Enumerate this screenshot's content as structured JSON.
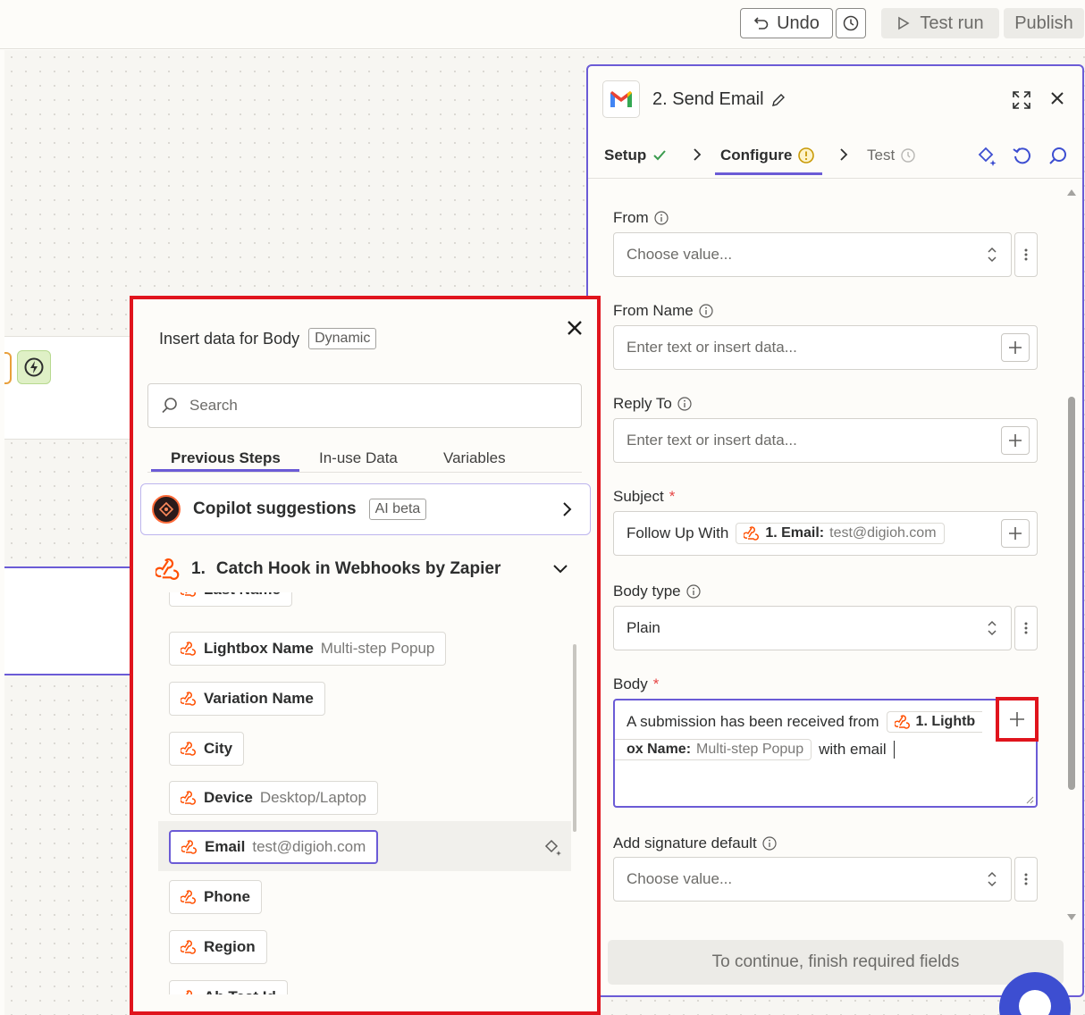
{
  "toolbar": {
    "undo_label": "Undo",
    "test_run_label": "Test run",
    "publish_label": "Publish"
  },
  "editor": {
    "title": "2. Send Email",
    "tabs": {
      "setup": "Setup",
      "configure": "Configure",
      "test": "Test"
    },
    "fields": {
      "from": {
        "label": "From",
        "placeholder": "Choose value..."
      },
      "from_name": {
        "label": "From Name",
        "placeholder": "Enter text or insert data..."
      },
      "reply_to": {
        "label": "Reply To",
        "placeholder": "Enter text or insert data..."
      },
      "subject": {
        "label": "Subject",
        "required": "*",
        "text": "Follow Up With",
        "pill_key": "1. Email:",
        "pill_value": "test@digioh.com"
      },
      "body_type": {
        "label": "Body type",
        "value": "Plain"
      },
      "body": {
        "label": "Body",
        "required": "*",
        "text1": "A submission has been received from",
        "pill_key1": "1. Lightb",
        "pill_key2": "ox Name:",
        "pill_value": "Multi-step Popup",
        "text2": "with email"
      },
      "signature": {
        "label": "Add signature default",
        "placeholder": "Choose value..."
      }
    },
    "continue_label": "To continue, finish required fields"
  },
  "insert_panel": {
    "title": "Insert data for Body",
    "badge": "Dynamic",
    "search_placeholder": "Search",
    "tabs": [
      "Previous Steps",
      "In-use Data",
      "Variables"
    ],
    "copilot_title": "Copilot suggestions",
    "copilot_badge": "AI beta",
    "step_num": "1.",
    "step_title": "Catch Hook in Webhooks by Zapier",
    "items": [
      {
        "key": "Last Name",
        "value": ""
      },
      {
        "key": "Lightbox Name",
        "value": "Multi-step Popup"
      },
      {
        "key": "Variation Name",
        "value": ""
      },
      {
        "key": "City",
        "value": ""
      },
      {
        "key": "Device",
        "value": "Desktop/Laptop"
      },
      {
        "key": "Email",
        "value": "test@digioh.com"
      },
      {
        "key": "Phone",
        "value": ""
      },
      {
        "key": "Region",
        "value": ""
      },
      {
        "key": "Ab Test Id",
        "value": ""
      }
    ]
  },
  "colors": {
    "accent": "#6b5bd6",
    "highlight_red": "#e0141d",
    "zapier_orange": "#ff4f00"
  }
}
